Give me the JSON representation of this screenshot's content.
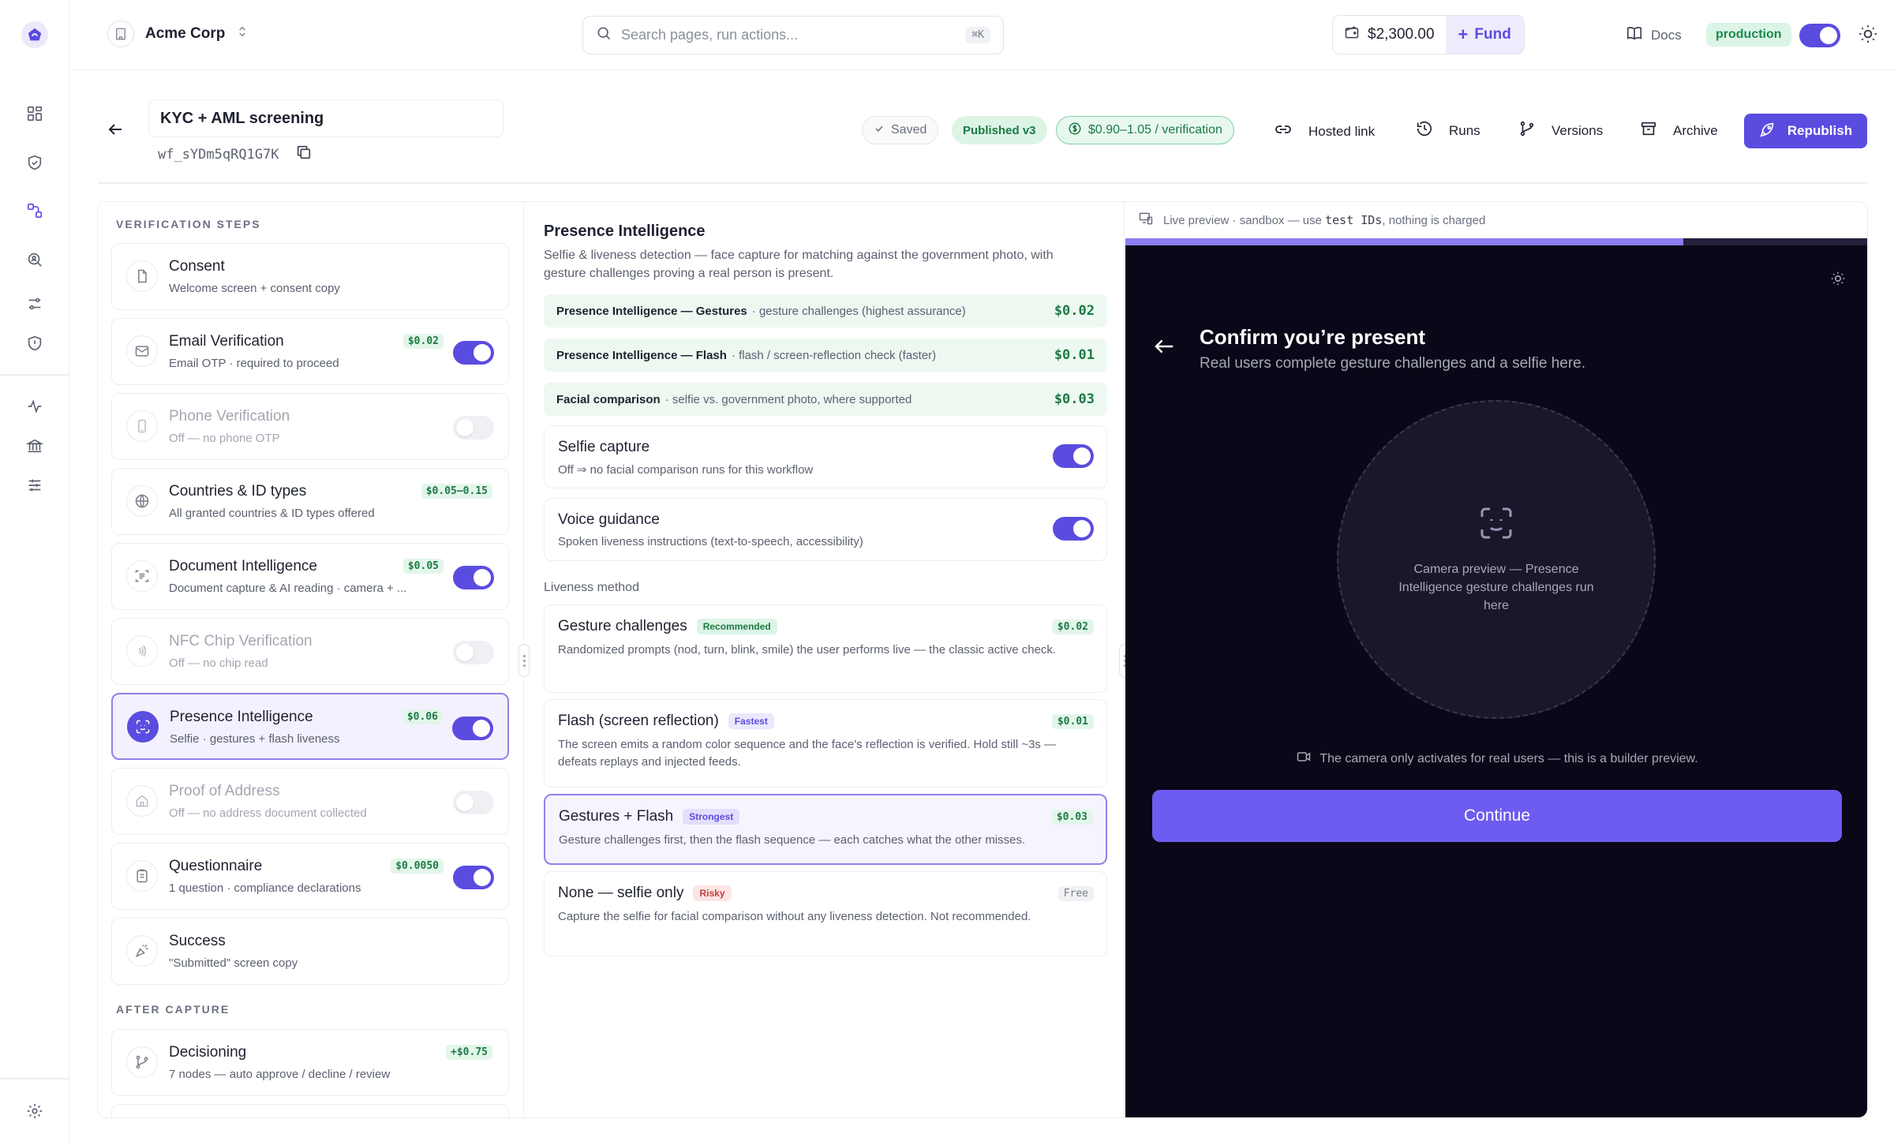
{
  "org": {
    "name": "Acme Corp"
  },
  "search": {
    "placeholder": "Search pages, run actions...",
    "shortcut": "⌘K"
  },
  "wallet": {
    "balance": "$2,300.00",
    "fund_label": "Fund"
  },
  "docs_label": "Docs",
  "environment": {
    "label": "production",
    "enabled": true
  },
  "rail": {
    "icons": [
      "grid-icon",
      "shield-check-icon",
      "workflow-icon",
      "search-user-icon",
      "sliders-icon",
      "shield-alert-icon",
      "activity-icon",
      "bank-icon",
      "settings-sliders-icon"
    ],
    "footer_icon": "gear-icon"
  },
  "workflow": {
    "title": "KYC + AML screening",
    "id": "wf_sYDm5qRQ1G7K",
    "status_saved": "Saved",
    "status_published": "Published v3",
    "price_range": "$0.90–1.05 / verification"
  },
  "actions": {
    "hosted_link": "Hosted link",
    "runs": "Runs",
    "versions": "Versions",
    "archive": "Archive",
    "republish": "Republish"
  },
  "steps_section_title": "VERIFICATION STEPS",
  "steps": [
    {
      "name": "Consent",
      "desc": "Welcome screen + consent copy",
      "price": "",
      "toggle": "none",
      "state": "normal",
      "icon": "document-icon"
    },
    {
      "name": "Email Verification",
      "desc": "Email OTP · required to proceed",
      "price": "$0.02",
      "toggle": "on",
      "state": "normal",
      "icon": "mail-icon"
    },
    {
      "name": "Phone Verification",
      "desc": "Off — no phone OTP",
      "price": "",
      "toggle": "off",
      "state": "disabled",
      "icon": "phone-icon"
    },
    {
      "name": "Countries & ID types",
      "desc": "All granted countries & ID types offered",
      "price": "$0.05–0.15",
      "toggle": "none",
      "state": "normal",
      "icon": "globe-icon"
    },
    {
      "name": "Document Intelligence",
      "desc": "Document capture & AI reading · camera + ...",
      "price": "$0.05",
      "toggle": "on",
      "state": "normal",
      "icon": "document-scan-icon"
    },
    {
      "name": "NFC Chip Verification",
      "desc": "Off — no chip read",
      "price": "",
      "toggle": "off",
      "state": "disabled",
      "icon": "nfc-icon"
    },
    {
      "name": "Presence Intelligence",
      "desc": "Selfie · gestures + flash liveness",
      "price": "$0.06",
      "toggle": "on",
      "state": "selected",
      "icon": "face-scan-icon"
    },
    {
      "name": "Proof of Address",
      "desc": "Off — no address document collected",
      "price": "",
      "toggle": "off",
      "state": "disabled",
      "icon": "home-icon"
    },
    {
      "name": "Questionnaire",
      "desc": "1 question · compliance declarations",
      "price": "$0.0050",
      "toggle": "on",
      "state": "normal",
      "icon": "clipboard-icon"
    },
    {
      "name": "Success",
      "desc": "\"Submitted\" screen copy",
      "price": "",
      "toggle": "none",
      "state": "normal",
      "icon": "party-icon"
    }
  ],
  "after_capture_title": "AFTER CAPTURE",
  "after_steps": [
    {
      "name": "Decisioning",
      "desc": "7 nodes — auto approve / decline / review",
      "price": "+$0.75",
      "icon": "branch-icon"
    }
  ],
  "detail": {
    "title": "Presence Intelligence",
    "description": "Selfie & liveness detection — face capture for matching against the government photo, with gesture challenges proving a real person is present.",
    "price_rows": [
      {
        "name": "Presence Intelligence — Gestures",
        "desc": "· gesture challenges (highest assurance)",
        "price": "$0.02"
      },
      {
        "name": "Presence Intelligence — Flash",
        "desc": "· flash / screen-reflection check (faster)",
        "price": "$0.01"
      },
      {
        "name": "Facial comparison",
        "desc": "· selfie vs. government photo, where supported",
        "price": "$0.03"
      }
    ],
    "toggles": [
      {
        "name": "Selfie capture",
        "desc": "Off ⇒ no facial comparison runs for this workflow",
        "on": true
      },
      {
        "name": "Voice guidance",
        "desc": "Spoken liveness instructions (text-to-speech, accessibility)",
        "on": true
      }
    ],
    "liveness_label": "Liveness method",
    "liveness_options": [
      {
        "name": "Gesture challenges",
        "tag": "Recommended",
        "tag_kind": "rec",
        "price": "$0.02",
        "desc": "Randomized prompts (nod, turn, blink, smile) the user performs live — the classic active check.",
        "selected": false
      },
      {
        "name": "Flash (screen reflection)",
        "tag": "Fastest",
        "tag_kind": "fast",
        "price": "$0.01",
        "desc": "The screen emits a random color sequence and the face's reflection is verified. Hold still ~3s — defeats replays and injected feeds.",
        "selected": false
      },
      {
        "name": "Gestures + Flash",
        "tag": "Strongest",
        "tag_kind": "strong",
        "price": "$0.03",
        "desc": "Gesture challenges first, then the flash sequence — each catches what the other misses.",
        "selected": true
      },
      {
        "name": "None — selfie only",
        "tag": "Risky",
        "tag_kind": "risky",
        "price": "Free",
        "desc": "Capture the selfie for facial comparison without any liveness detection. Not recommended.",
        "selected": false
      }
    ]
  },
  "preview": {
    "header_prefix": "Live preview · sandbox — use",
    "header_code": "test IDs",
    "header_suffix": ", nothing is charged",
    "progress": 0.75,
    "title": "Confirm you’re present",
    "subtitle": "Real users complete gesture challenges and a selfie here.",
    "camera_text": "Camera preview — Presence Intelligence gesture challenges run here",
    "note": "The camera only activates for real users — this is a builder preview.",
    "continue_label": "Continue"
  },
  "colors": {
    "accent": "#5b4ce0",
    "success": "#1d7a45",
    "preview_bg": "#0a0818"
  }
}
